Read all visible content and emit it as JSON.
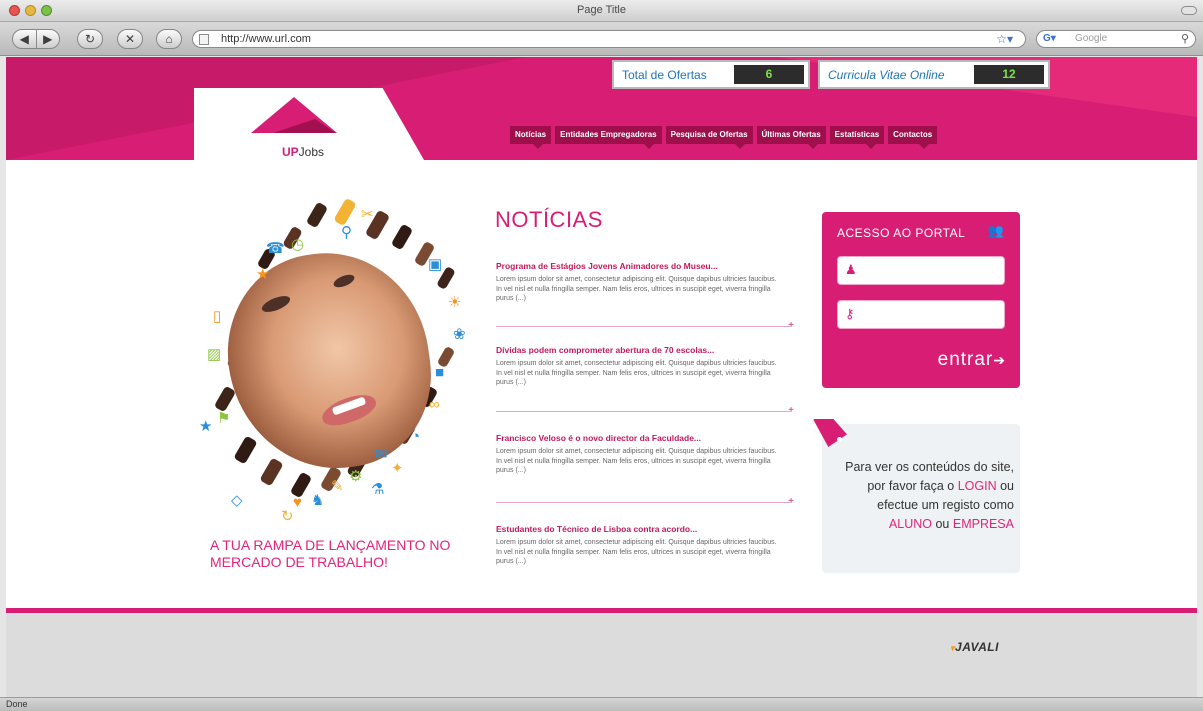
{
  "browser": {
    "title": "Page Title",
    "url": "http://www.url.com",
    "search_placeholder": "Google",
    "status": "Done"
  },
  "header": {
    "logo_up": "UP",
    "logo_rest": "Jobs",
    "counters": [
      {
        "label": "Total de Ofertas",
        "value": "6"
      },
      {
        "label": "Curricula Vitae Online",
        "value": "12"
      }
    ],
    "nav": [
      "Notícias",
      "Entidades Empregadoras",
      "Pesquisa de Ofertas",
      "Últimas Ofertas",
      "Estatísticas",
      "Contactos"
    ]
  },
  "hero": {
    "tagline": "A tua rampa de lançamento no mercado de trabalho!"
  },
  "news": {
    "title": "NOTÍCIAS",
    "items": [
      {
        "headline": "Programa de Estágios Jovens Animadores do Museu...",
        "body": "Lorem ipsum dolor sit amet, consectetur adipiscing elit. Quisque dapibus ultricies faucibus. In vel nisl et nulla fringilla semper. Nam felis eros, ultrices in suscipit eget, viverra fringilla purus (...)"
      },
      {
        "headline": "Dívidas podem comprometer abertura de 70 escolas...",
        "body": "Lorem ipsum dolor sit amet, consectetur adipiscing elit. Quisque dapibus ultricies faucibus. In vel nisl et nulla fringilla semper. Nam felis eros, ultrices in suscipit eget, viverra fringilla purus (...)"
      },
      {
        "headline": "Francisco Veloso é o novo director da Faculdade...",
        "body": "Lorem ipsum dolor sit amet, consectetur adipiscing elit. Quisque dapibus ultricies faucibus. In vel nisl et nulla fringilla semper. Nam felis eros, ultrices in suscipit eget, viverra fringilla purus (...)"
      },
      {
        "headline": "Estudantes do Técnico de Lisboa contra acordo...",
        "body": "Lorem ipsum dolor sit amet, consectetur adipiscing elit. Quisque dapibus ultricies faucibus. In vel nisl et nulla fringilla semper. Nam felis eros, ultrices in suscipit eget, viverra fringilla purus (...)"
      }
    ]
  },
  "login": {
    "title": "ACESSO AO PORTAL",
    "submit_label": "entrar"
  },
  "info": {
    "text_1": "Para ver os conteúdos do site, por favor faça o",
    "login_link": "LOGIN",
    "text_2": "ou efectue um registo como",
    "aluno_link": "ALUNO",
    "text_3": "ou",
    "empresa_link": "EMPRESA"
  },
  "footer": {
    "logo": "JAVALI"
  },
  "colors": {
    "brand_pink": "#d81e74",
    "brand_dark": "#9e0f4c",
    "counter_green": "#7ee24a"
  }
}
